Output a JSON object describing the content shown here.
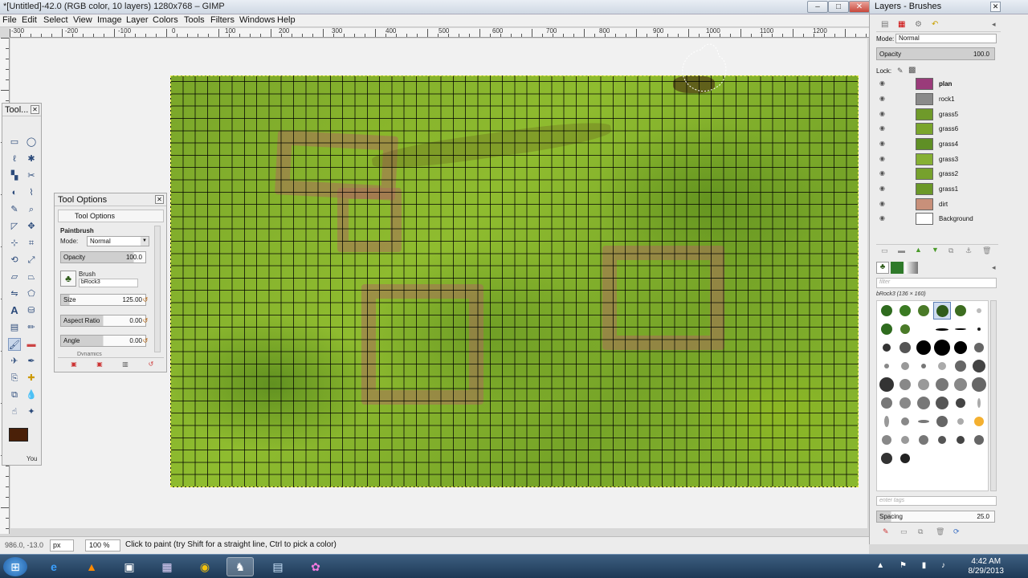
{
  "window": {
    "title": "*[Untitled]-42.0 (RGB color, 10 layers) 1280x768 – GIMP"
  },
  "menu": [
    {
      "label": "File"
    },
    {
      "label": "Edit"
    },
    {
      "label": "Select"
    },
    {
      "label": "View"
    },
    {
      "label": "Image"
    },
    {
      "label": "Layer"
    },
    {
      "label": "Colors"
    },
    {
      "label": "Tools"
    },
    {
      "label": "Filters"
    },
    {
      "label": "Windows"
    },
    {
      "label": "Help"
    }
  ],
  "ruler": {
    "labels": [
      "-300",
      "-200",
      "-100",
      "0",
      "100",
      "200",
      "300",
      "400",
      "500",
      "600",
      "700",
      "800",
      "900",
      "1000",
      "1100",
      "1200"
    ]
  },
  "toolbox": {
    "title": "Tool...",
    "you_label": "You",
    "fg_color": "#4a2008",
    "bg_color": "#ffffff"
  },
  "tool_options": {
    "dock_title": "Tool Options",
    "tab_title": "Tool Options",
    "tool_name": "Paintbrush",
    "mode_label": "Mode:",
    "mode_value": "Normal",
    "opacity_label": "Opacity",
    "opacity_value": "100.0",
    "brush_label": "Brush",
    "brush_value": "bRock3",
    "size_label": "Size",
    "size_value": "125.00",
    "aspect_label": "Aspect Ratio",
    "aspect_value": "0.00",
    "angle_label": "Angle",
    "angle_value": "0.00",
    "dynamics_label": "Dynamics"
  },
  "layers_dock": {
    "window_title": "Layers - Brushes",
    "mode_label": "Mode:",
    "mode_value": "Normal",
    "opacity_label": "Opacity",
    "opacity_value": "100.0",
    "lock_label": "Lock:",
    "layers": [
      {
        "name": "plan",
        "color": "#9a3b7a"
      },
      {
        "name": "rock1",
        "color": "#8a8a8a"
      },
      {
        "name": "grass5",
        "color": "#6f9a2a"
      },
      {
        "name": "grass6",
        "color": "#7aa52c"
      },
      {
        "name": "grass4",
        "color": "#5f8f25"
      },
      {
        "name": "grass3",
        "color": "#86b033"
      },
      {
        "name": "grass2",
        "color": "#76a12d"
      },
      {
        "name": "grass1",
        "color": "#6b9828"
      },
      {
        "name": "dirt",
        "color": "#c8907a"
      },
      {
        "name": "Background",
        "color": "#ffffff"
      }
    ],
    "brushes_filter_placeholder": "filter",
    "brush_info": "bRock3 (136 × 160)",
    "tags_placeholder": "enter tags",
    "spacing_label": "Spacing",
    "spacing_value": "25.0"
  },
  "statusbar": {
    "coords": "986.0, -13.0",
    "unit": "px",
    "zoom": "100 %",
    "message": "Click to paint (try Shift for a straight line, Ctrl to pick a color)"
  },
  "taskbar": {
    "time": "4:42 AM",
    "date": "8/29/2013"
  }
}
